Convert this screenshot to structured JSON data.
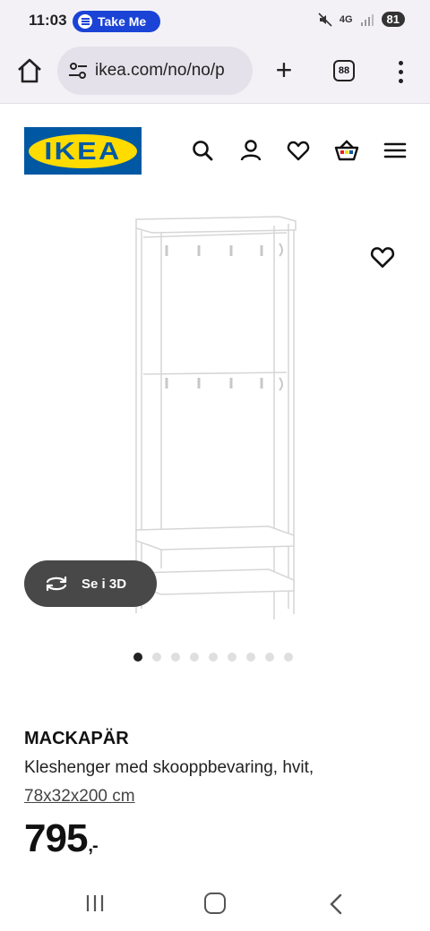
{
  "status_bar": {
    "time": "11:03",
    "media_pill": "Take Me",
    "network": "4G",
    "battery": "81"
  },
  "browser": {
    "url": "ikea.com/no/no/p",
    "tab_count": "88"
  },
  "header": {
    "logo_text": "IKEA",
    "icons": [
      "search-icon",
      "user-icon",
      "heart-icon",
      "cart-icon",
      "hamburger-icon"
    ]
  },
  "gallery": {
    "view_3d_label": "Se i 3D",
    "dot_count": 9,
    "active_dot": 0
  },
  "product": {
    "name": "MACKAPÄR",
    "description": "Kleshenger med skooppbevaring, hvit,",
    "dimensions": "78x32x200 cm",
    "price": "795",
    "price_suffix": ",-"
  },
  "colors": {
    "ikea_blue": "#0058a3",
    "ikea_yellow": "#ffdb00",
    "browser_bg": "#f3f1f6",
    "pill_blue": "#1b43d6"
  }
}
